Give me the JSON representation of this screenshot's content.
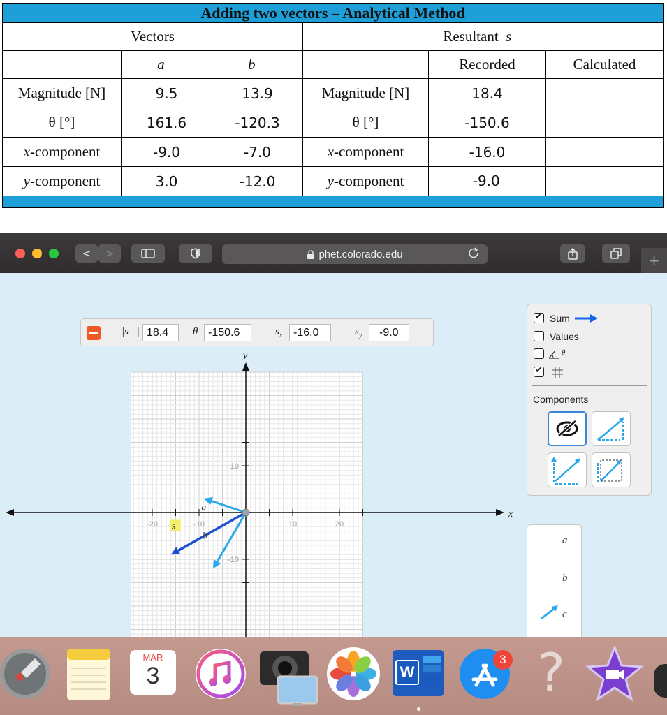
{
  "table": {
    "title": "Adding two vectors – Analytical Method",
    "vectors_header": "Vectors",
    "resultant_header": "Resultant",
    "resultant_symbol": "s⃗",
    "vec_a": "a⃗",
    "vec_b": "b⃗",
    "recorded": "Recorded",
    "calculated": "Calculated",
    "rows": [
      {
        "label": "Magnitude [N]",
        "a": "9.5",
        "b": "13.9",
        "rlabel": "Magnitude [N]",
        "recorded": "18.4",
        "calc": ""
      },
      {
        "label": "θ [°]",
        "a": "161.6",
        "b": "-120.3",
        "rlabel": "θ [°]",
        "recorded": "-150.6",
        "calc": ""
      },
      {
        "label_var": "x",
        "label_rest": "-component",
        "a": "-9.0",
        "b": "-7.0",
        "rlabel_var": "x",
        "rlabel_rest": "-component",
        "recorded": "-16.0",
        "calc": ""
      },
      {
        "label_var": "y",
        "label_rest": "-component",
        "a": "3.0",
        "b": "-12.0",
        "rlabel_var": "y",
        "rlabel_rest": "-component",
        "recorded": "-9.0",
        "calc": ""
      }
    ]
  },
  "browser": {
    "url": "phet.colorado.edu",
    "back": "<",
    "forward": ">",
    "new_tab": "+"
  },
  "readout": {
    "mag_label": "|s⃗|",
    "mag": "18.4",
    "theta_label": "θ",
    "theta": "-150.6",
    "sx_label": "s",
    "sx_sub": "x",
    "sx": "-16.0",
    "sy_label": "s",
    "sy_sub": "y",
    "sy": "-9.0"
  },
  "controls": {
    "sum_label": "Sum",
    "sum_checked": true,
    "values_label": "Values",
    "values_checked": false,
    "angle_checked": false,
    "angle_label": "θ",
    "grid_checked": true,
    "components_label": "Components"
  },
  "bucket": {
    "a": "a⃗",
    "b": "b⃗",
    "c": "c⃗"
  },
  "graph": {
    "x_axis_label": "x",
    "y_axis_label": "y",
    "x_ticks": [
      "-20",
      "-10",
      "10",
      "20"
    ],
    "y_ticks": [
      "10",
      "-10"
    ],
    "vector_a_label": "a⃗",
    "vector_b_label": "b⃗",
    "vector_s_label": "s⃗",
    "vectors": {
      "a": {
        "x": -9,
        "y": 3
      },
      "b": {
        "x": -7,
        "y": -12
      },
      "s": {
        "x": -16,
        "y": -9
      }
    },
    "colors": {
      "a": "#2aa8e8",
      "b": "#2aa8e8",
      "s": "#1b4fd1",
      "sum_icon": "#1565e6"
    }
  },
  "dock": {
    "calendar_month": "MAR",
    "calendar_day": "3",
    "word_letter": "W",
    "appstore_badge": "3",
    "help_glyph": "?"
  }
}
